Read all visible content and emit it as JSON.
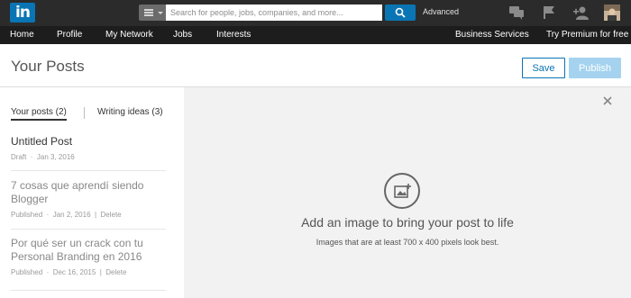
{
  "header": {
    "logo_text": "in",
    "search_placeholder": "Search for people, jobs, companies, and more...",
    "advanced_label": "Advanced",
    "icons": [
      "messages-icon",
      "flag-icon",
      "add-connection-icon",
      "profile-avatar"
    ]
  },
  "nav": {
    "items": [
      "Home",
      "Profile",
      "My Network",
      "Jobs",
      "Interests"
    ],
    "right_items": [
      "Business Services",
      "Try Premium for free"
    ]
  },
  "page": {
    "title": "Your Posts",
    "save_label": "Save",
    "publish_label": "Publish"
  },
  "tabs": {
    "your_posts": "Your posts (2)",
    "writing_ideas": "Writing ideas (3)"
  },
  "posts": [
    {
      "title": "Untitled Post",
      "status": "Draft",
      "date": "Jan 3, 2016",
      "delete": ""
    },
    {
      "title": "7 cosas que aprendí siendo Blogger",
      "status": "Published",
      "date": "Jan 2, 2016",
      "delete": "Delete"
    },
    {
      "title": "Por qué ser un crack con tu Personal Branding en 2016",
      "status": "Published",
      "date": "Dec 16, 2015",
      "delete": "Delete"
    }
  ],
  "editor": {
    "cta": "Add an image to bring your post to life",
    "hint": "Images that are at least 700 x 400 pixels look best."
  },
  "colors": {
    "topbar": "#2b2b2b",
    "navbar": "#1d1d1d",
    "brand_blue": "#0a75b4",
    "publish_disabled": "#a5d3ef"
  }
}
